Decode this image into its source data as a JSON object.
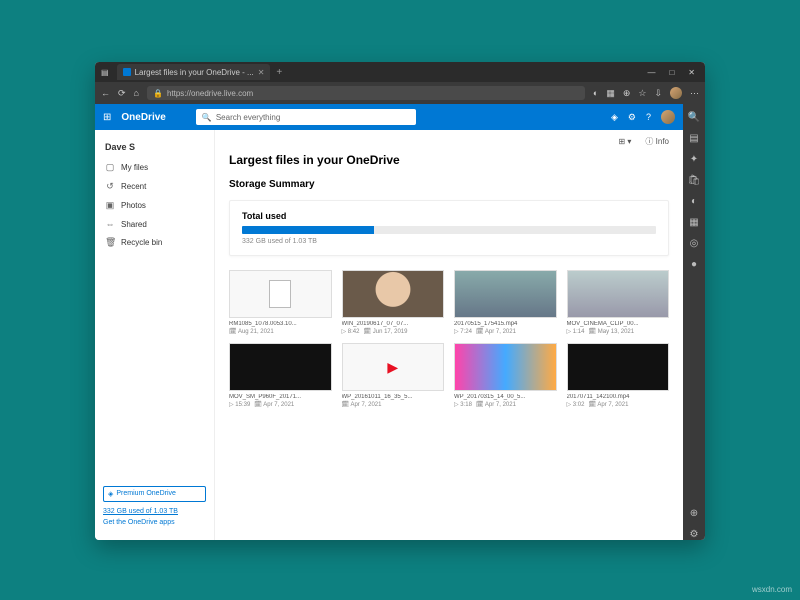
{
  "browser": {
    "tab_title": "Largest files in your OneDrive - ...",
    "url": "https://onedrive.live.com",
    "winbtns": [
      "—",
      "□",
      "✕"
    ]
  },
  "od": {
    "brand": "OneDrive",
    "search_placeholder": "Search everything",
    "user": "Dave S",
    "nav": [
      {
        "icon": "▢",
        "label": "My files"
      },
      {
        "icon": "↺",
        "label": "Recent"
      },
      {
        "icon": "▣",
        "label": "Photos"
      },
      {
        "icon": "⇔",
        "label": "Shared"
      },
      {
        "icon": "🗑",
        "label": "Recycle bin"
      }
    ],
    "premium_label": "Premium OneDrive",
    "storage_footer": "332 GB used of 1.03 TB",
    "getapps": "Get the OneDrive apps",
    "toolbar": {
      "view": "⊞ ▾",
      "info": "ⓘ Info"
    },
    "title": "Largest files in your OneDrive",
    "summary_heading": "Storage Summary",
    "total_used_label": "Total used",
    "total_used_text": "332 GB used of 1.03 TB",
    "used_pct": 32
  },
  "files": [
    {
      "name": "RM1085_1078.0053.10...",
      "dur": "",
      "date": "Aug 21, 2021",
      "cls": "doc"
    },
    {
      "name": "WIN_20190617_07_07...",
      "dur": "8:42",
      "date": "Jun 17, 2019",
      "cls": "face"
    },
    {
      "name": "20170515_175415.mp4",
      "dur": "7:24",
      "date": "Apr 7, 2021",
      "cls": "scene"
    },
    {
      "name": "MOV_CINEMA_CLIP_00...",
      "dur": "1:14",
      "date": "May 13, 2021",
      "cls": "room"
    },
    {
      "name": "MOV_SM_P960F_20171...",
      "dur": "15:39",
      "date": "Apr 7, 2021",
      "cls": "dark"
    },
    {
      "name": "WP_20161011_16_35_5...",
      "dur": "",
      "date": "Apr 7, 2021",
      "cls": "play"
    },
    {
      "name": "WP_20170315_14_00_5...",
      "dur": "3:18",
      "date": "Apr 7, 2021",
      "cls": "colorful"
    },
    {
      "name": "20170711_142100.mp4",
      "dur": "3:02",
      "date": "Apr 7, 2021",
      "cls": "dark"
    }
  ],
  "watermark": "wsxdn.com"
}
